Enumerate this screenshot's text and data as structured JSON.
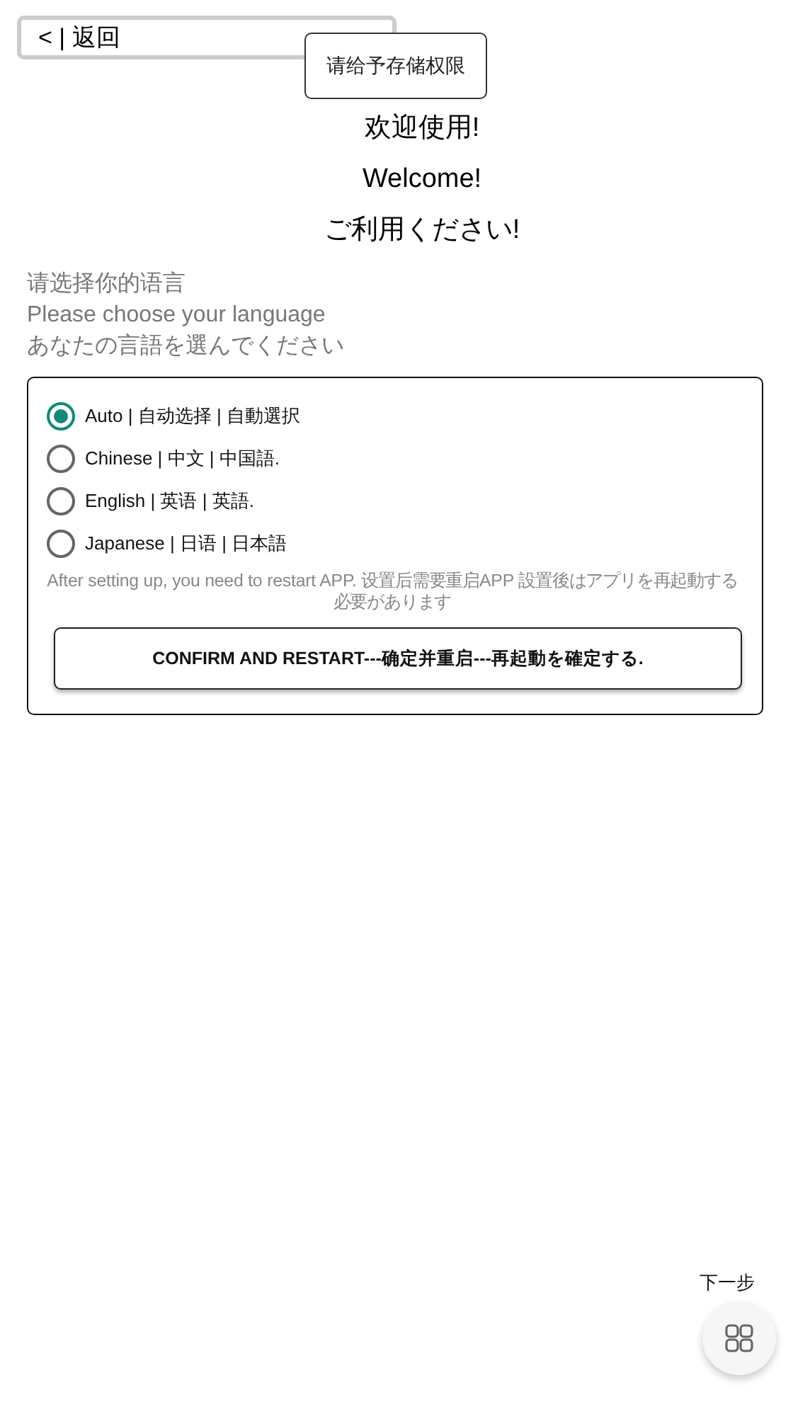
{
  "back_button": {
    "label": "< | 返回"
  },
  "permission_notice": {
    "text": "请给予存储权限"
  },
  "welcome": [
    "欢迎使用!",
    "Welcome!",
    "ご利用ください!"
  ],
  "prompt": [
    "请选择你的语言",
    "Please choose your language",
    "あなたの言語を選んでください"
  ],
  "languages": [
    {
      "label": "Auto | 自动选择 | 自動選択",
      "selected": true
    },
    {
      "label": "Chinese | 中文 | 中国語.",
      "selected": false
    },
    {
      "label": "English | 英语 | 英語.",
      "selected": false
    },
    {
      "label": "Japanese | 日语 | 日本語",
      "selected": false
    }
  ],
  "restart_note": "After setting up, you need to restart APP. 设置后需要重启APP 設置後はアプリを再起動する必要があります",
  "confirm_button": {
    "label": "CONFIRM AND RESTART---确定并重启---再起動を確定する."
  },
  "next_button": {
    "label": "下一步"
  }
}
